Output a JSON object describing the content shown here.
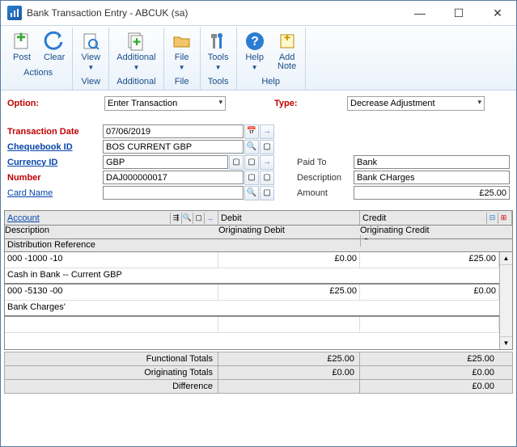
{
  "window": {
    "title": "Bank Transaction Entry  -  ABCUK (sa)"
  },
  "ribbon": {
    "groups": [
      {
        "label": "Actions",
        "buttons": [
          {
            "label": "Post",
            "arrow": false,
            "icon": "post"
          },
          {
            "label": "Clear",
            "arrow": false,
            "icon": "clear"
          }
        ]
      },
      {
        "label": "View",
        "buttons": [
          {
            "label": "View",
            "arrow": true,
            "icon": "view"
          }
        ]
      },
      {
        "label": "Additional",
        "buttons": [
          {
            "label": "Additional",
            "arrow": true,
            "icon": "additional"
          }
        ]
      },
      {
        "label": "File",
        "buttons": [
          {
            "label": "File",
            "arrow": true,
            "icon": "file"
          }
        ]
      },
      {
        "label": "Tools",
        "buttons": [
          {
            "label": "Tools",
            "arrow": true,
            "icon": "tools"
          }
        ]
      },
      {
        "label": "Help",
        "buttons": [
          {
            "label": "Help",
            "arrow": true,
            "icon": "help"
          },
          {
            "label": "Add Note",
            "arrow": false,
            "icon": "note"
          }
        ]
      }
    ]
  },
  "form": {
    "option_label": "Option:",
    "option_value": "Enter Transaction",
    "type_label": "Type:",
    "type_value": "Decrease Adjustment",
    "transaction_date_label": "Transaction Date",
    "transaction_date_value": "07/06/2019",
    "chequebook_id_label": "Chequebook ID",
    "chequebook_id_value": "BOS CURRENT GBP",
    "currency_id_label": "Currency ID",
    "currency_id_value": "GBP",
    "number_label": "Number",
    "number_value": "DAJ000000017",
    "card_name_label": "Card Name",
    "card_name_value": "",
    "paid_to_label": "Paid To",
    "paid_to_value": "Bank",
    "description_label": "Description",
    "description_value": "Bank CHarges",
    "amount_label": "Amount",
    "amount_value": "£25.00"
  },
  "grid": {
    "headers": {
      "account": "Account",
      "debit": "Debit",
      "credit": "Credit",
      "description": "Description",
      "orig_debit": "Originating Debit",
      "orig_credit": "Originating Credit",
      "dist_ref": "Distribution Reference"
    },
    "rows": [
      {
        "account": "000 -1000 -10",
        "debit": "£0.00",
        "credit": "£25.00",
        "description": "Cash in Bank -- Current GBP"
      },
      {
        "account": "000 -5130 -00",
        "debit": "£25.00",
        "credit": "£0.00",
        "description": "Bank Charges'"
      }
    ]
  },
  "totals": {
    "functional_label": "Functional Totals",
    "functional_debit": "£25.00",
    "functional_credit": "£25.00",
    "originating_label": "Originating Totals",
    "originating_debit": "£0.00",
    "originating_credit": "£0.00",
    "difference_label": "Difference",
    "difference_value": "£0.00"
  }
}
